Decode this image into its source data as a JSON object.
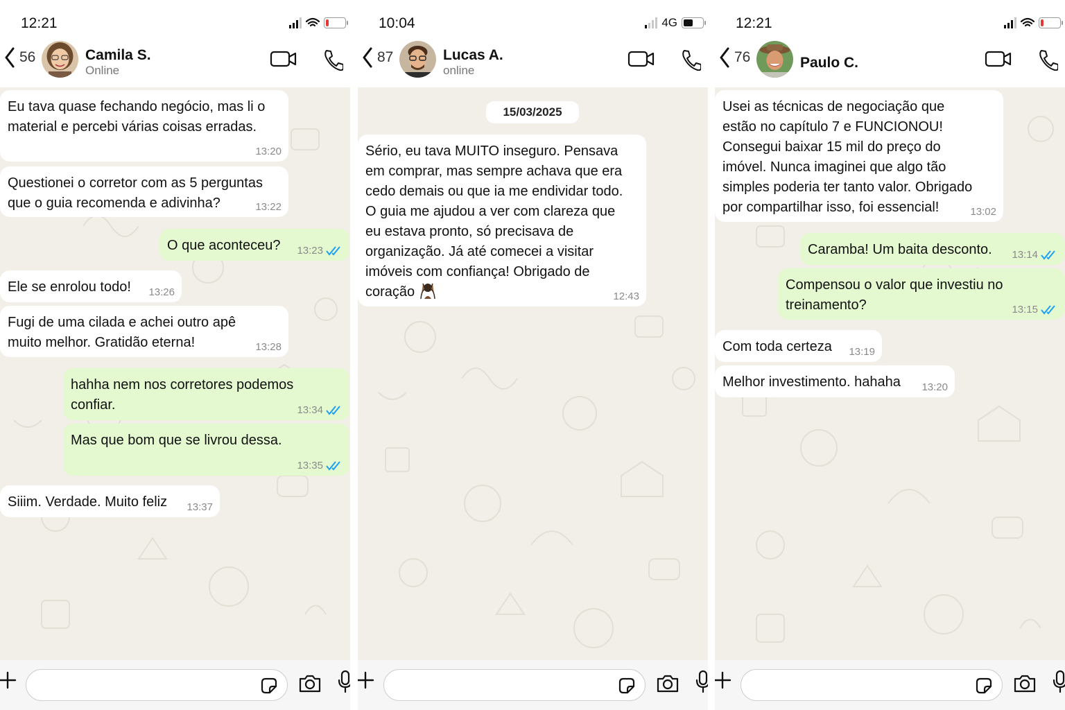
{
  "colors": {
    "incoming_bubble": "#ffffff",
    "outgoing_bubble": "#e4f9d0",
    "chat_background": "#f2efe8",
    "read_ticks": "#1da1f2",
    "low_battery": "#e53935"
  },
  "icons": {
    "back": "chevron-left-icon",
    "video": "video-camera-icon",
    "call": "phone-icon",
    "attach": "plus-icon",
    "sticker": "sticker-icon",
    "camera": "camera-icon",
    "mic": "microphone-icon",
    "read": "double-check-icon",
    "emoji": "raising-hands-emoji"
  },
  "chats": [
    {
      "status_time": "12:21",
      "network": "",
      "battery_level": 0.12,
      "unread": "56",
      "contact": {
        "name": "Camila S.",
        "status": "Online"
      },
      "date_label": "",
      "messages": [
        {
          "dir": "in",
          "text": "Eu tava quase fechando negócio, mas li o\nmaterial e percebi várias coisas erradas.",
          "time": "13:20"
        },
        {
          "dir": "in",
          "text": "Questionei o corretor com as 5 perguntas\nque o guia recomenda e adivinha?",
          "time": "13:22"
        },
        {
          "dir": "out",
          "text": "O que aconteceu?",
          "time": "13:23",
          "read": true
        },
        {
          "dir": "in",
          "text": "Ele se enrolou todo!",
          "time": "13:26"
        },
        {
          "dir": "in",
          "text": "Fugi de uma cilada e achei outro apê\nmuito melhor. Gratidão eterna!",
          "time": "13:28"
        },
        {
          "dir": "out",
          "text": "hahha nem nos corretores podemos\nconfiar.",
          "time": "13:34",
          "read": true
        },
        {
          "dir": "out",
          "text": "Mas que bom que se livrou dessa.",
          "time": "13:35",
          "read": true
        },
        {
          "dir": "in",
          "text": "Siiim. Verdade. Muito feliz",
          "time": "13:37"
        }
      ]
    },
    {
      "status_time": "10:04",
      "network": "4G",
      "battery_level": 0.5,
      "unread": "87",
      "contact": {
        "name": "Lucas A.",
        "status": "online"
      },
      "date_label": "15/03/2025",
      "messages": [
        {
          "dir": "in",
          "text": "Sério, eu tava MUITO inseguro. Pensava\nem comprar, mas sempre achava que era\ncedo demais ou que ia me endividar todo.\nO guia me ajudou a ver com clareza que\neu estava pronto, só precisava de\norganização. Já até comecei a visitar\nimóveis com confiança! Obrigado de\ncoração",
          "time": "12:43",
          "emoji": "raising-hands-emoji"
        }
      ]
    },
    {
      "status_time": "12:21",
      "network": "",
      "battery_level": 0.12,
      "unread": "76",
      "contact": {
        "name": "Paulo C.",
        "status": ""
      },
      "date_label": "",
      "messages": [
        {
          "dir": "in",
          "text": "Usei as técnicas de negociação que\nestão no capítulo 7 e FUNCIONOU!\nConsegui baixar 15 mil do preço do\nimóvel. Nunca imaginei que algo tão\nsimples poderia ter tanto valor. Obrigado\npor compartilhar isso, foi essencial!",
          "time": "13:02"
        },
        {
          "dir": "out",
          "text": "Caramba! Um baita desconto.",
          "time": "13:14",
          "read": true
        },
        {
          "dir": "out",
          "text": "Compensou o valor que investiu no\ntreinamento?",
          "time": "13:15",
          "read": true
        },
        {
          "dir": "in",
          "text": "Com toda certeza",
          "time": "13:19"
        },
        {
          "dir": "in",
          "text": "Melhor investimento. hahaha",
          "time": "13:20"
        }
      ]
    }
  ]
}
